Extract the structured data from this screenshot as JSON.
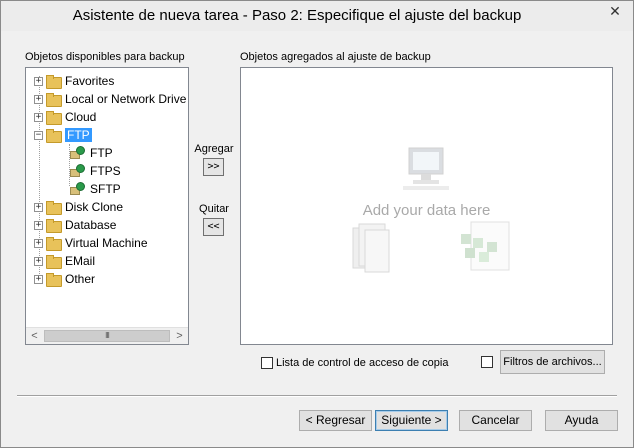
{
  "window": {
    "title": "Asistente de nueva tarea - Paso 2: Especifique el ajuste del backup",
    "close_glyph": "✕"
  },
  "left_panel": {
    "label": "Objetos disponibles para backup",
    "items": [
      {
        "label": "Favorites",
        "icon": "folder-icon",
        "expander": "+"
      },
      {
        "label": "Local or Network Drive",
        "icon": "folder-icon",
        "expander": "+"
      },
      {
        "label": "Cloud",
        "icon": "folder-icon",
        "expander": "+"
      },
      {
        "label": "FTP",
        "icon": "folder-icon",
        "expander": "−",
        "selected": true
      },
      {
        "label": "FTP",
        "icon": "network-computer-icon",
        "child": true
      },
      {
        "label": "FTPS",
        "icon": "network-computer-icon",
        "child": true
      },
      {
        "label": "SFTP",
        "icon": "network-computer-icon",
        "child": true
      },
      {
        "label": "Disk Clone",
        "icon": "folder-icon",
        "expander": "+"
      },
      {
        "label": "Database",
        "icon": "folder-icon",
        "expander": "+"
      },
      {
        "label": "Virtual Machine",
        "icon": "folder-icon",
        "expander": "+"
      },
      {
        "label": "EMail",
        "icon": "folder-icon",
        "expander": "+"
      },
      {
        "label": "Other",
        "icon": "folder-icon",
        "expander": "+"
      }
    ],
    "scroll_left": "<",
    "scroll_right": ">",
    "scroll_grip": "III"
  },
  "middle": {
    "add_label": "Agregar",
    "add_button": ">>",
    "remove_label": "Quitar",
    "remove_button": "<<"
  },
  "right_panel": {
    "label": "Objetos agregados al ajuste de backup",
    "placeholder": "Add your data here"
  },
  "options": {
    "acl_label": "Lista de control de acceso de copia",
    "acl_checked": false,
    "filter_checked": false,
    "filter_button": "Filtros de archivos..."
  },
  "footer": {
    "back": "< Regresar",
    "next": "Siguiente >",
    "cancel": "Cancelar",
    "help": "Ayuda"
  },
  "colors": {
    "selection": "#3399ff",
    "folder": "#e8c25a",
    "placeholder_text": "#a9a9a9"
  }
}
